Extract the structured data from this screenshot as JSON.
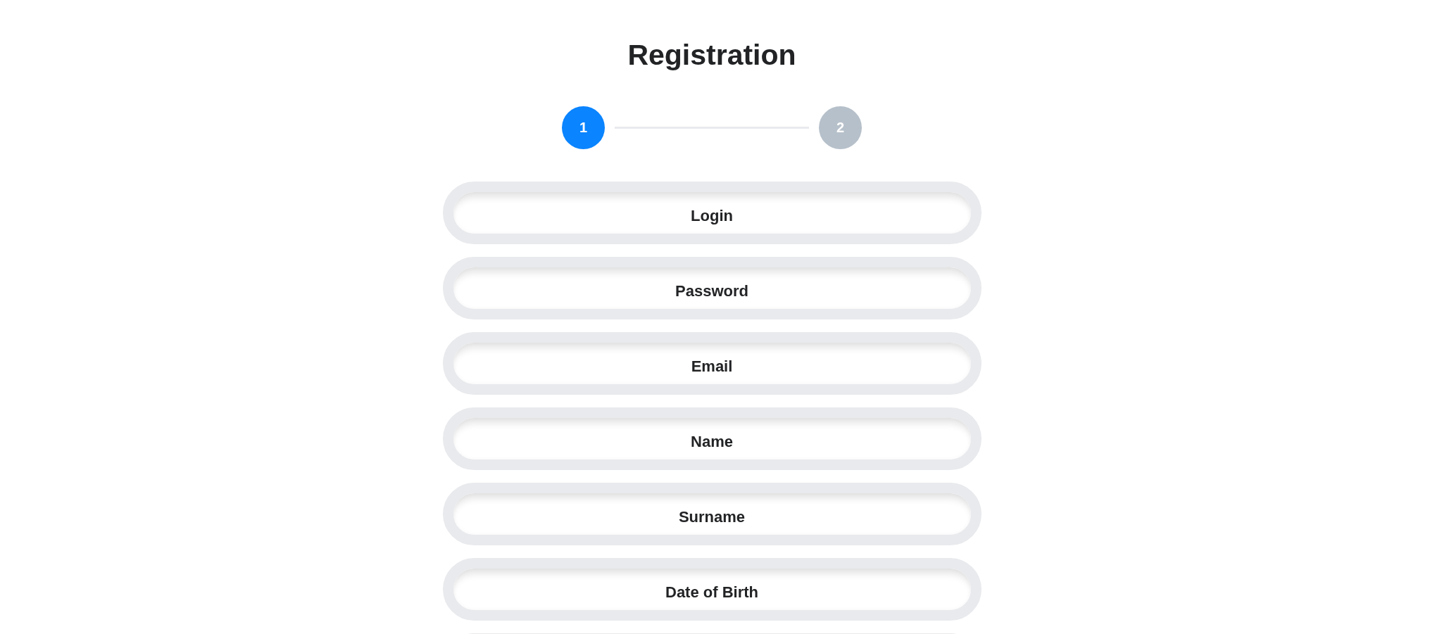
{
  "title": "Registration",
  "steps": [
    {
      "label": "1",
      "selected": true
    },
    {
      "label": "2",
      "selected": false
    }
  ],
  "fields": [
    {
      "placeholder": "Login"
    },
    {
      "placeholder": "Password"
    },
    {
      "placeholder": "Email"
    },
    {
      "placeholder": "Name"
    },
    {
      "placeholder": "Surname"
    },
    {
      "placeholder": "Date of Birth"
    }
  ],
  "more_fields_below": true
}
